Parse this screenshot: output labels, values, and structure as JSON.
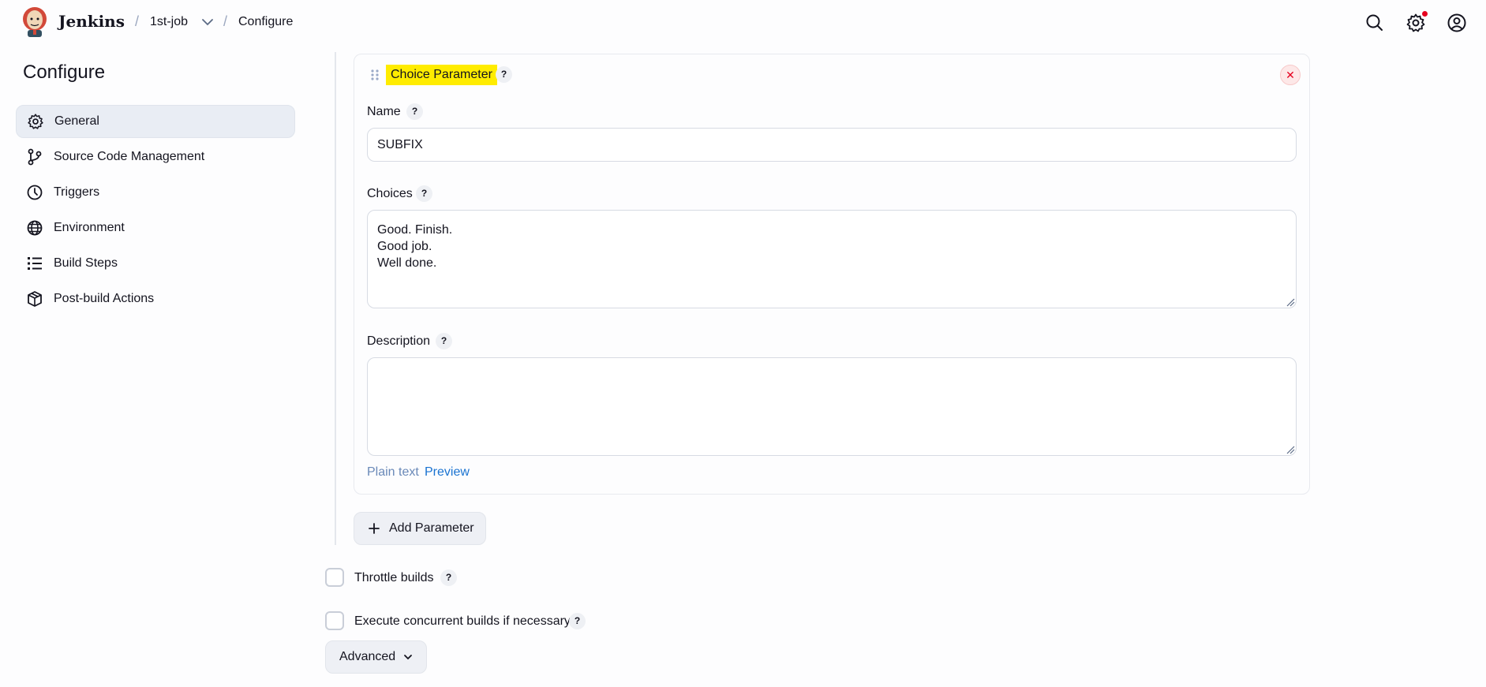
{
  "header": {
    "brand": "Jenkins",
    "breadcrumb": [
      {
        "label": "1st-job"
      },
      {
        "label": "Configure"
      }
    ],
    "separator": "/"
  },
  "sidebar": {
    "title": "Configure",
    "items": [
      {
        "label": "General",
        "icon": "gear-icon",
        "active": true
      },
      {
        "label": "Source Code Management",
        "icon": "branch-icon"
      },
      {
        "label": "Triggers",
        "icon": "clock-icon"
      },
      {
        "label": "Environment",
        "icon": "globe-icon"
      },
      {
        "label": "Build Steps",
        "icon": "list-icon"
      },
      {
        "label": "Post-build Actions",
        "icon": "package-icon"
      }
    ]
  },
  "parameter": {
    "title": "Choice Parameter",
    "help": "?",
    "close": "✕",
    "name_label": "Name",
    "name_value": "SUBFIX",
    "choices_label": "Choices",
    "choices_value": "Good. Finish.\nGood job.\nWell done.",
    "description_label": "Description",
    "description_value": "",
    "plain_text": "Plain text",
    "preview": "Preview"
  },
  "add_parameter": {
    "label": "Add Parameter",
    "icon": "plus-icon"
  },
  "options": [
    {
      "label": "Throttle builds",
      "checked": false
    },
    {
      "label": "Execute concurrent builds if necessary",
      "checked": false
    }
  ],
  "advanced": {
    "label": "Advanced",
    "icon": "chevron-down-icon"
  },
  "colors": {
    "highlight": "#ffec00",
    "link": "#1a73d1",
    "danger": "#e6001f"
  }
}
